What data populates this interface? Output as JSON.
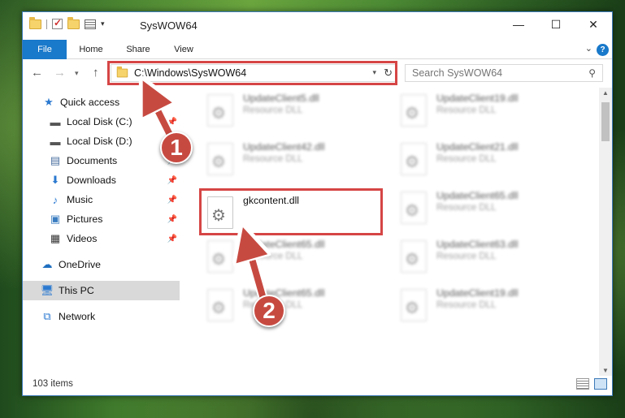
{
  "window": {
    "title": "SysWOW64"
  },
  "ribbon": {
    "tabs": [
      "File",
      "Home",
      "Share",
      "View"
    ],
    "help_icon": "help-icon"
  },
  "address": {
    "path": "C:\\Windows\\SysWOW64"
  },
  "search": {
    "placeholder": "Search SysWOW64"
  },
  "sidebar": {
    "items": [
      {
        "label": "Quick access",
        "icon": "star-icon",
        "pinned": false
      },
      {
        "label": "Local Disk (C:)",
        "icon": "drive-icon",
        "pinned": true
      },
      {
        "label": "Local Disk (D:)",
        "icon": "drive-icon",
        "pinned": true
      },
      {
        "label": "Documents",
        "icon": "documents-icon",
        "pinned": true
      },
      {
        "label": "Downloads",
        "icon": "download-icon",
        "pinned": true
      },
      {
        "label": "Music",
        "icon": "music-icon",
        "pinned": true
      },
      {
        "label": "Pictures",
        "icon": "pictures-icon",
        "pinned": true
      },
      {
        "label": "Videos",
        "icon": "videos-icon",
        "pinned": true
      },
      {
        "label": "OneDrive",
        "icon": "cloud-icon",
        "pinned": false
      },
      {
        "label": "This PC",
        "icon": "computer-icon",
        "pinned": false,
        "selected": true
      },
      {
        "label": "Network",
        "icon": "network-icon",
        "pinned": false
      }
    ]
  },
  "files": [
    {
      "name": "UpdateClient5.dll",
      "type": "Resource DLL",
      "blurred": true
    },
    {
      "name": "UpdateClient19.dll",
      "type": "Resource DLL",
      "blurred": true
    },
    {
      "name": "UpdateClient42.dll",
      "type": "Resource DLL",
      "blurred": true
    },
    {
      "name": "UpdateClient21.dll",
      "type": "Resource DLL",
      "blurred": true
    },
    {
      "name": "gkcontent.dll",
      "type": "",
      "blurred": false
    },
    {
      "name": "UpdateClient65.dll",
      "type": "Resource DLL",
      "blurred": true
    },
    {
      "name": "UpdateClient65.dll",
      "type": "Resource DLL",
      "blurred": true
    },
    {
      "name": "UpdateClient63.dll",
      "type": "Resource DLL",
      "blurred": true
    },
    {
      "name": "UpdateClient65.dll",
      "type": "Resource DLL",
      "blurred": true
    },
    {
      "name": "UpdateClient19.dll",
      "type": "Resource DLL",
      "blurred": true
    }
  ],
  "status": {
    "item_count": "103 items"
  },
  "callouts": {
    "step1": "1",
    "step2": "2",
    "color": "#c74a41"
  }
}
